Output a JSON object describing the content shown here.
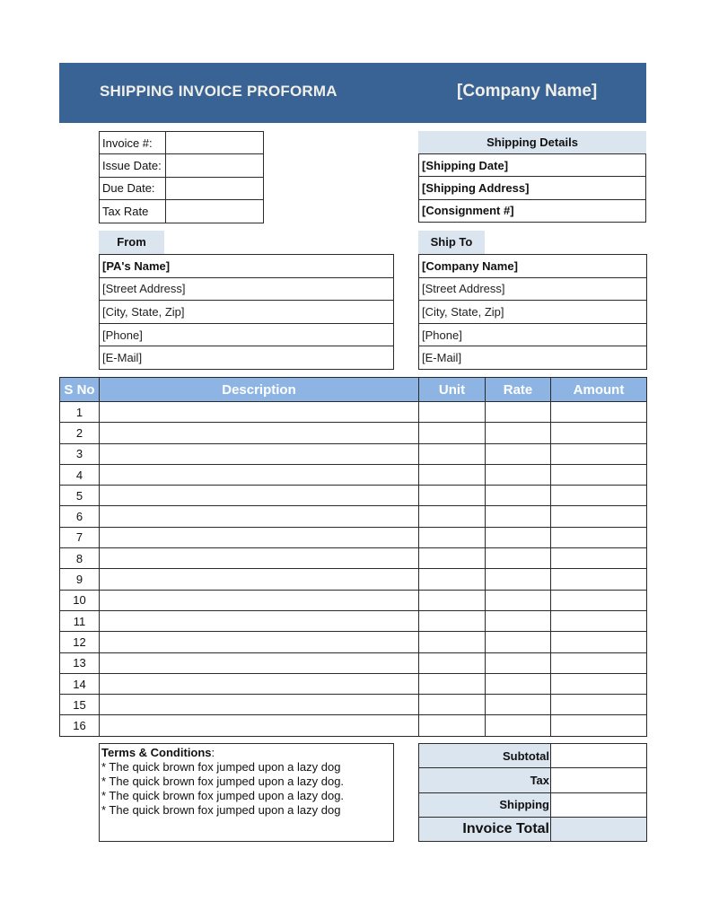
{
  "header": {
    "title": "SHIPPING INVOICE PROFORMA",
    "company": "[Company Name]",
    "bg_color": "#3a6395"
  },
  "invoice_info": [
    {
      "label": "Invoice #:",
      "value": ""
    },
    {
      "label": "Issue Date:",
      "value": ""
    },
    {
      "label": "Due Date:",
      "value": ""
    },
    {
      "label": "Tax Rate",
      "value": ""
    }
  ],
  "shipping_details": {
    "title": "Shipping Details",
    "rows": [
      "[Shipping Date]",
      "[Shipping Address]",
      "[Consignment #]"
    ]
  },
  "from": {
    "title": "From",
    "rows": [
      "[PA's Name]",
      "[Street Address]",
      "[City, State, Zip]",
      "[Phone]",
      "[E-Mail]"
    ]
  },
  "ship_to": {
    "title": "Ship To",
    "rows": [
      "[Company Name]",
      "[Street Address]",
      "[City, State, Zip]",
      "[Phone]",
      "[E-Mail]"
    ]
  },
  "items_table": {
    "columns": [
      "S No",
      "Description",
      "Unit",
      "Rate",
      "Amount"
    ],
    "header_color": "#8eb4e3",
    "rows": [
      {
        "sno": "1",
        "description": "",
        "unit": "",
        "rate": "",
        "amount": ""
      },
      {
        "sno": "2",
        "description": "",
        "unit": "",
        "rate": "",
        "amount": ""
      },
      {
        "sno": "3",
        "description": "",
        "unit": "",
        "rate": "",
        "amount": ""
      },
      {
        "sno": "4",
        "description": "",
        "unit": "",
        "rate": "",
        "amount": ""
      },
      {
        "sno": "5",
        "description": "",
        "unit": "",
        "rate": "",
        "amount": ""
      },
      {
        "sno": "6",
        "description": "",
        "unit": "",
        "rate": "",
        "amount": ""
      },
      {
        "sno": "7",
        "description": "",
        "unit": "",
        "rate": "",
        "amount": ""
      },
      {
        "sno": "8",
        "description": "",
        "unit": "",
        "rate": "",
        "amount": ""
      },
      {
        "sno": "9",
        "description": "",
        "unit": "",
        "rate": "",
        "amount": ""
      },
      {
        "sno": "10",
        "description": "",
        "unit": "",
        "rate": "",
        "amount": ""
      },
      {
        "sno": "11",
        "description": "",
        "unit": "",
        "rate": "",
        "amount": ""
      },
      {
        "sno": "12",
        "description": "",
        "unit": "",
        "rate": "",
        "amount": ""
      },
      {
        "sno": "13",
        "description": "",
        "unit": "",
        "rate": "",
        "amount": ""
      },
      {
        "sno": "14",
        "description": "",
        "unit": "",
        "rate": "",
        "amount": ""
      },
      {
        "sno": "15",
        "description": "",
        "unit": "",
        "rate": "",
        "amount": ""
      },
      {
        "sno": "16",
        "description": "",
        "unit": "",
        "rate": "",
        "amount": ""
      }
    ]
  },
  "terms": {
    "title": "Terms & Conditions",
    "colon": ":",
    "lines": [
      "* The quick brown fox jumped upon a lazy dog",
      "* The quick brown fox jumped upon a lazy dog.",
      "* The quick brown fox jumped upon a lazy dog.",
      "* The quick brown fox jumped upon a lazy dog"
    ]
  },
  "totals": [
    {
      "label": "Subtotal",
      "value": ""
    },
    {
      "label": "Tax",
      "value": ""
    },
    {
      "label": "Shipping",
      "value": ""
    },
    {
      "label": "Invoice Total",
      "value": ""
    }
  ],
  "accent_light": "#dbe5f0"
}
